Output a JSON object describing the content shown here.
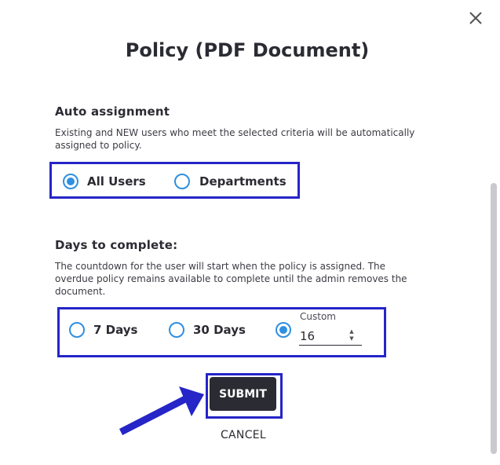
{
  "dialog": {
    "title": "Policy (PDF Document)",
    "close_icon": "close-icon"
  },
  "auto_assignment": {
    "heading": "Auto assignment",
    "description": "Existing and NEW users who meet the selected criteria will be automatically assigned to policy.",
    "options": [
      {
        "label": "All Users",
        "checked": true
      },
      {
        "label": "Departments",
        "checked": false
      }
    ]
  },
  "days_to_complete": {
    "heading": "Days to complete:",
    "description": "The countdown for the user will start when the policy is assigned. The overdue policy remains available to complete until the admin removes the document.",
    "options": [
      {
        "label": "7 Days",
        "checked": false
      },
      {
        "label": "30 Days",
        "checked": false
      },
      {
        "label": "Custom",
        "checked": true
      }
    ],
    "custom": {
      "caption": "Custom",
      "value": "16"
    }
  },
  "actions": {
    "submit_label": "SUBMIT",
    "cancel_label": "CANCEL"
  },
  "colors": {
    "highlight": "#2525c8",
    "radio": "#2f8fe0",
    "button": "#2b2b33"
  }
}
